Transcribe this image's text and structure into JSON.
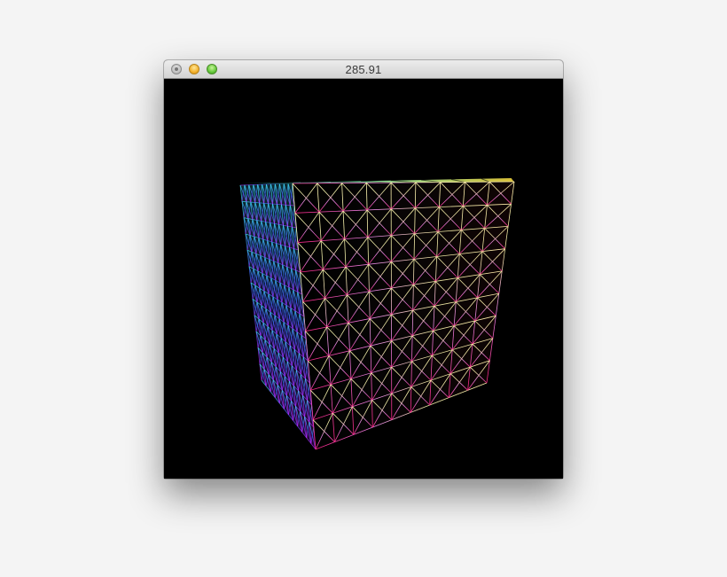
{
  "window": {
    "title": "285.91",
    "buttons": {
      "close": "close-button",
      "minimize": "minimize-button",
      "zoom": "zoom-button"
    }
  },
  "scene": {
    "object": "cube",
    "render_mode": "wireframe",
    "grid_subdivisions": 9,
    "background_color": "#000000",
    "colors": {
      "top_back_left": "#30f0ff",
      "top_front_left": "#fff8a0",
      "top_back_right": "#ffd84a",
      "top_front_right": "#ffe040",
      "bottom_front_left": "#e040e0",
      "bottom_front_right": "#ff2050",
      "bottom_back_left": "#6020ff"
    }
  }
}
